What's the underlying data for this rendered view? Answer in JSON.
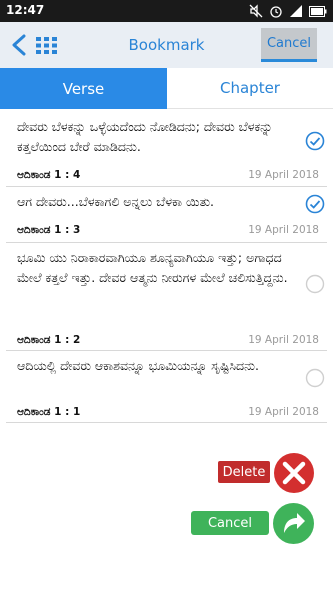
{
  "status_bar": {
    "time": "12:47",
    "battery": "battery-icon",
    "signal": "signal-icon",
    "alarm": "alarm-icon",
    "mute": "mute-icon"
  },
  "header": {
    "title": "Bookmark",
    "cancel_label": "Cancel"
  },
  "tabs": [
    {
      "label": "Verse",
      "active": true
    },
    {
      "label": "Chapter",
      "active": false
    }
  ],
  "bookmarks": [
    {
      "text": "ದೇವರು ಬೆಳಕನ್ನು ಒಳ್ಳೆಯದೆಂದು ನೋಡಿದನು; ದೇವರು ಬೆಳಕನ್ನು ಕತ್ತಲೆಯಿಂದ ಬೇರೆ ಮಾಡಿದನು.",
      "book": "ಆದಿಕಾಂಡ",
      "ref": "1 : 4",
      "date": "19 April 2018",
      "selected": true
    },
    {
      "text": "ಆಗ ದೇವರು...ಬೆಳಕಾಗಲಿ ಅನ್ನಲು ಬೆಳಕಾ ಯಿತು.",
      "book": "ಆದಿಕಾಂಡ",
      "ref": "1 : 3",
      "date": "19 April 2018",
      "selected": true
    },
    {
      "text": "ಭೂಮಿ ಯು ನಿರಾಕಾರವಾಗಿಯೂ ಶೂನ್ಯವಾಗಿಯೂ ಇತ್ತು; ಅಗಾಧದ ಮೇಲೆ ಕತ್ತಲೆ ಇತ್ತು. ದೇವರ ಆತ್ಮನು ನೀರುಗಳ ಮೇಲೆ ಚಲಿಸುತ್ತಿದ್ದನು.",
      "book": "ಆದಿಕಾಂಡ",
      "ref": "1 : 2",
      "date": "19 April 2018",
      "selected": false
    },
    {
      "text": "ಆದಿಯಲ್ಲಿ ದೇವರು ಆಕಾಶವನ್ನೂ ಭೂಮಿಯನ್ನೂ ಸೃಷ್ಟಿಸಿದನು.",
      "book": "ಆದಿಕಾಂಡ",
      "ref": "1 : 1",
      "date": "19 April 2018",
      "selected": false
    }
  ],
  "actions": {
    "delete_label": "Delete",
    "cancel_label": "Cancel"
  },
  "colors": {
    "accent": "#2a8ae6",
    "delete": "#c12c2c",
    "confirm": "#3fb35a"
  }
}
